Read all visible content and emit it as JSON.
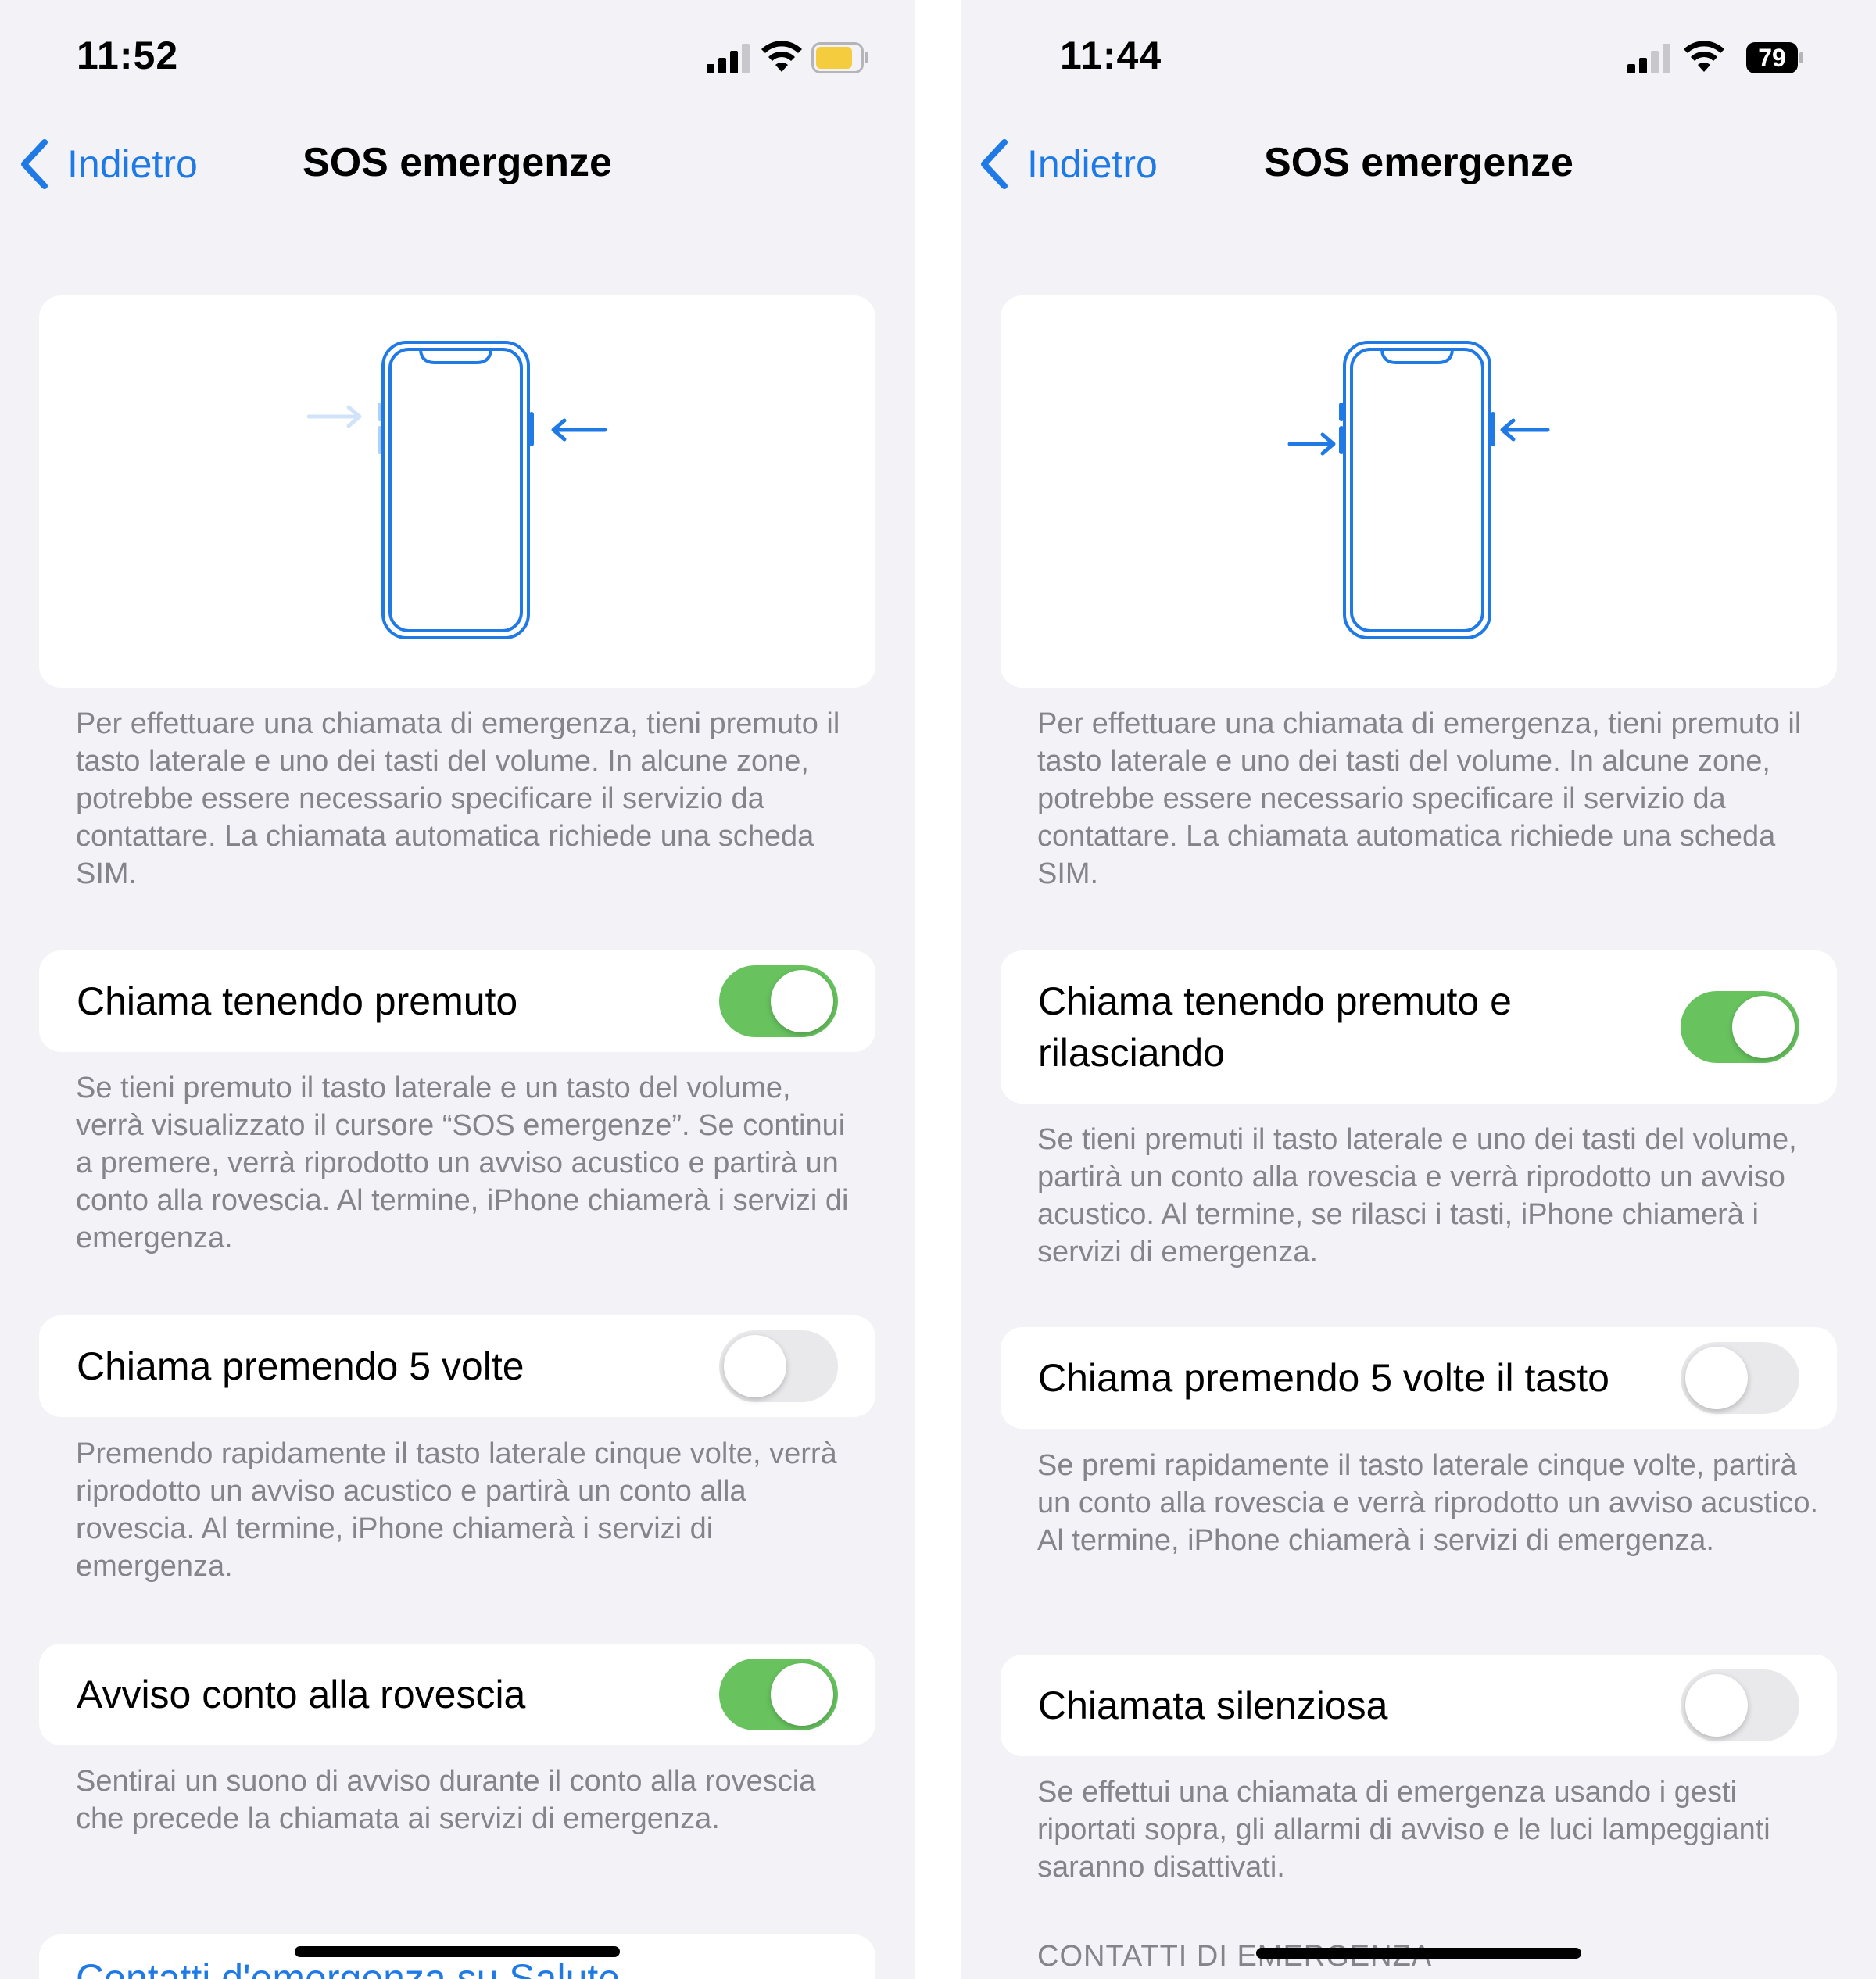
{
  "colors": {
    "accent": "#1f7ae6",
    "background": "#f2f2f7",
    "toggle_on": "#68c35f",
    "toggle_off": "#e9e9eb",
    "footnote_text": "#84848a"
  },
  "left": {
    "status": {
      "time": "11:52",
      "battery_icon": "battery-low-yellow-icon"
    },
    "nav": {
      "back_label": "Indietro",
      "title": "SOS emergenze"
    },
    "illustration_text": "Per effettuare una chiamata di emergenza, tieni premuto il tasto laterale e uno dei tasti del volume. In alcune zone, potrebbe essere necessario specificare il servizio da contattare. La chiamata automatica richiede una scheda SIM.",
    "settings": [
      {
        "label": "Chiama tenendo premuto",
        "enabled": true,
        "footnote": "Se tieni premuto il tasto laterale e un tasto del volume, verrà visualizzato il cursore “SOS emergenze”. Se continui a premere, verrà riprodotto un avviso acustico e partirà un conto alla rovescia. Al termine, iPhone chiamerà i servizi di emergenza."
      },
      {
        "label": "Chiama premendo 5 volte",
        "enabled": false,
        "footnote": "Premendo rapidamente il tasto laterale cinque volte, verrà riprodotto un avviso acustico e partirà un conto alla rovescia. Al termine, iPhone chiamerà i servizi di emergenza."
      },
      {
        "label": "Avviso conto alla rovescia",
        "enabled": true,
        "footnote": "Sentirai un suono di avviso durante il conto alla rovescia che precede la chiamata ai servizi di emergenza."
      }
    ],
    "partial_row": "Contatti d'emergenza su Salute"
  },
  "right": {
    "status": {
      "time": "11:44",
      "battery": "79"
    },
    "nav": {
      "back_label": "Indietro",
      "title": "SOS emergenze"
    },
    "illustration_text": "Per effettuare una chiamata di emergenza, tieni premuto il tasto laterale e uno dei tasti del volume. In alcune zone, potrebbe essere necessario specificare il servizio da contattare. La chiamata automatica richiede una scheda SIM.",
    "settings": [
      {
        "label": "Chiama tenendo premuto e rilasciando",
        "enabled": true,
        "footnote": "Se tieni premuti il tasto laterale e uno dei tasti del volume, partirà un conto alla rovescia e verrà riprodotto un avviso acustico. Al termine, se rilasci i tasti, iPhone chiamerà i servizi di emergenza."
      },
      {
        "label": "Chiama premendo 5 volte il tasto",
        "enabled": false,
        "footnote": "Se premi rapidamente il tasto laterale cinque volte, partirà un conto alla rovescia e verrà riprodotto un avviso acustico. Al termine, iPhone chiamerà i servizi di emergenza."
      },
      {
        "label": "Chiamata silenziosa",
        "enabled": false,
        "footnote": "Se effettui una chiamata di emergenza usando i gesti riportati sopra, gli allarmi di avviso e le luci lampeggianti saranno disattivati."
      }
    ],
    "section_header": "CONTATTI DI EMERGENZA"
  }
}
